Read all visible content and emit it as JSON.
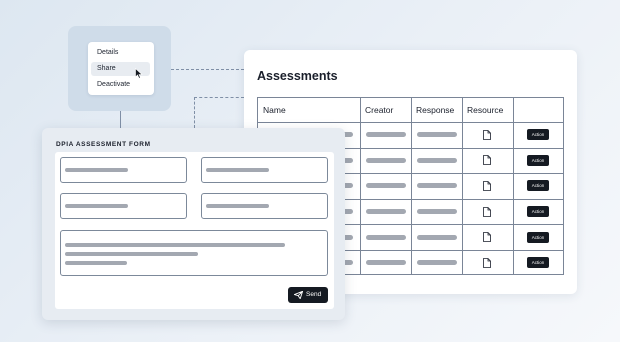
{
  "menu": {
    "items": [
      {
        "label": "Details",
        "active": false
      },
      {
        "label": "Share",
        "active": true
      },
      {
        "label": "Deactivate",
        "active": false
      }
    ]
  },
  "assessments": {
    "title": "Assessments",
    "columns": [
      "Name",
      "Creator",
      "Response",
      "Resource",
      ""
    ],
    "row_count": 6,
    "row_action_label": "Action",
    "resource_icon": "document-icon"
  },
  "form": {
    "title": "DPIA ASSESSMENT FORM",
    "send_label": "Send",
    "send_icon": "paper-plane-icon"
  },
  "colors": {
    "accent_dark": "#151a22",
    "placeholder_bar": "#a3a8b1",
    "border": "#7a8597"
  }
}
